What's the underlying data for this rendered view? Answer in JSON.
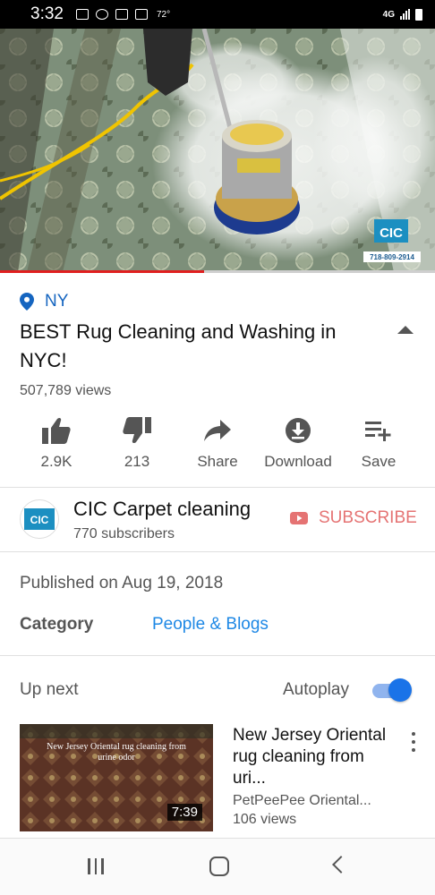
{
  "status_bar": {
    "time": "3:32",
    "temperature": "72°",
    "network": "4G",
    "icons": [
      "sim-icon",
      "wifi-call-icon",
      "mail-icon",
      "image-icon"
    ]
  },
  "video": {
    "watermark_text": "CIC",
    "phone_text": "718-809-2914",
    "progress": 0.47
  },
  "meta": {
    "location": "NY",
    "title": "BEST Rug Cleaning and Washing in NYC!",
    "views": "507,789 views"
  },
  "actions": [
    {
      "label": "2.9K",
      "icon": "thumb-up-icon"
    },
    {
      "label": "213",
      "icon": "thumb-down-icon"
    },
    {
      "label": "Share",
      "icon": "share-icon"
    },
    {
      "label": "Download",
      "icon": "download-icon"
    },
    {
      "label": "Save",
      "icon": "playlist-add-icon"
    }
  ],
  "channel": {
    "avatar_text": "CIC",
    "name": "CIC Carpet cleaning",
    "subscribers": "770 subscribers",
    "subscribe_label": "SUBSCRIBE"
  },
  "description": {
    "published": "Published on Aug 19, 2018",
    "category_label": "Category",
    "category_value": "People & Blogs"
  },
  "up_next": {
    "label": "Up next",
    "autoplay_label": "Autoplay",
    "autoplay_on": true
  },
  "recommendation": {
    "thumbnail_caption": "New Jersey Oriental rug cleaning from urine odor",
    "duration": "7:39",
    "title": "New Jersey Oriental rug cleaning from uri...",
    "channel": "PetPeePee Oriental...",
    "views": "106 views"
  },
  "colors": {
    "accent_blue": "#1565c0",
    "link_blue": "#1e88e5",
    "progress_red": "#e01f1f",
    "subscribe_red": "#e57373",
    "toggle_blue": "#1a73e8"
  }
}
